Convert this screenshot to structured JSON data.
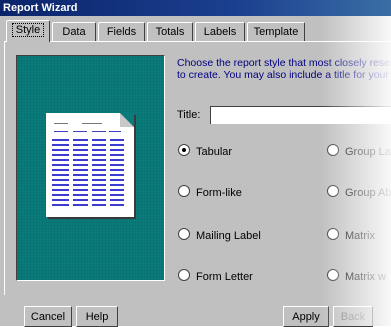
{
  "window": {
    "title": "Report Wizard"
  },
  "tabs": [
    {
      "label": "Style",
      "active": true
    },
    {
      "label": "Data"
    },
    {
      "label": "Fields"
    },
    {
      "label": "Totals"
    },
    {
      "label": "Labels"
    },
    {
      "label": "Template"
    }
  ],
  "description": {
    "line1": "Choose the report style that most closely resemble",
    "line2": "to create. You may also include a title for your repo"
  },
  "title_field": {
    "label": "Title:",
    "value": ""
  },
  "styles_left": [
    {
      "label": "Tabular",
      "selected": true
    },
    {
      "label": "Form-like",
      "selected": false
    },
    {
      "label": "Mailing Label",
      "selected": false
    },
    {
      "label": "Form Letter",
      "selected": false
    }
  ],
  "styles_right": [
    {
      "label": "Group La"
    },
    {
      "label": "Group Ab"
    },
    {
      "label": "Matrix"
    },
    {
      "label": "Matrix w"
    }
  ],
  "buttons": {
    "cancel": "Cancel",
    "help": "Help",
    "apply": "Apply",
    "back": "Back"
  },
  "colors": {
    "preview_bg": "#0a7a7a",
    "description_text": "#000080",
    "titlebar": "#0a246a"
  }
}
